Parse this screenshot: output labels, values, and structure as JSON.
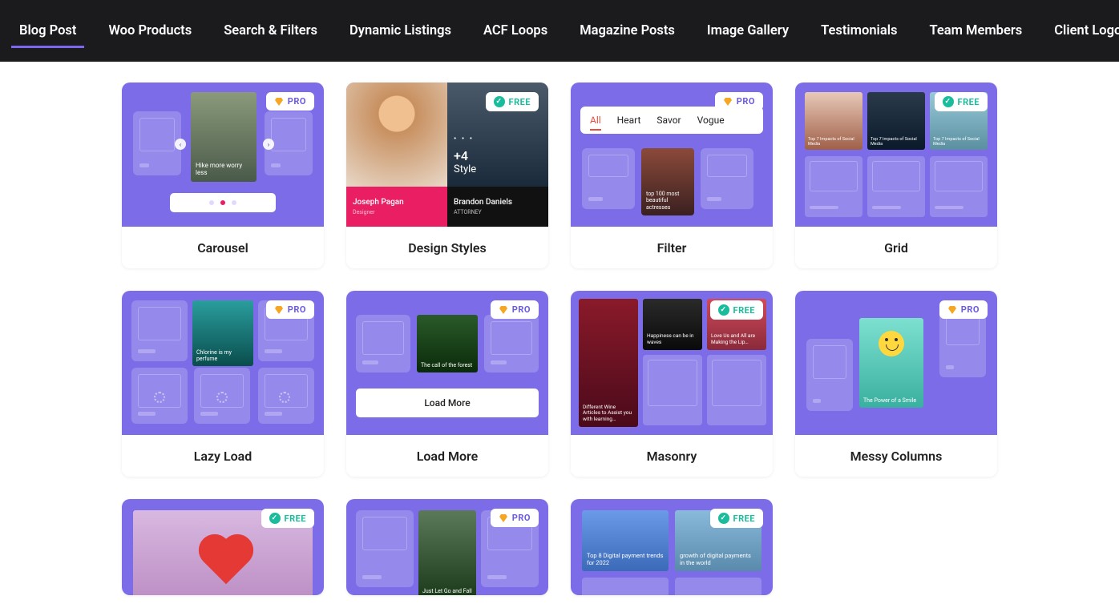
{
  "nav": {
    "items": [
      {
        "label": "Blog Post",
        "active": true
      },
      {
        "label": "Woo Products"
      },
      {
        "label": "Search & Filters"
      },
      {
        "label": "Dynamic Listings"
      },
      {
        "label": "ACF Loops"
      },
      {
        "label": "Magazine Posts"
      },
      {
        "label": "Image Gallery"
      },
      {
        "label": "Testimonials"
      },
      {
        "label": "Team Members"
      },
      {
        "label": "Client Logos"
      }
    ]
  },
  "badges": {
    "pro": "PRO",
    "free": "FREE"
  },
  "cards": {
    "carousel": {
      "title": "Carousel",
      "tier": "pro",
      "caption": "Hike more worry less"
    },
    "design_styles": {
      "title": "Design Styles",
      "tier": "free",
      "p1": {
        "name": "Joseph Pagan",
        "role": "Designer"
      },
      "p2": {
        "name": "Brandon Daniels",
        "role": "ATTORNEY"
      },
      "overlay_num": "+4",
      "overlay_word": "Style",
      "dots": "• • •"
    },
    "filter": {
      "title": "Filter",
      "tier": "pro",
      "tabs": [
        "All",
        "Heart",
        "Savor",
        "Vogue"
      ],
      "caption": "top 100 most beautiful actresses"
    },
    "grid": {
      "title": "Grid",
      "tier": "free",
      "tile_tag": "Social",
      "tile_caption": "Top 7 Impacts of Social Media"
    },
    "lazy": {
      "title": "Lazy Load",
      "tier": "pro",
      "caption": "Chlorine is my perfume"
    },
    "loadmore": {
      "title": "Load More",
      "tier": "pro",
      "caption": "The call of the forest",
      "button": "Load More"
    },
    "masonry": {
      "title": "Masonry",
      "tier": "free",
      "c1": "Different Wine Articles to Assist you with learning…",
      "c2": "Happiness can be in waves",
      "c3": "Love Us and All are Making the Lip…"
    },
    "messy": {
      "title": "Messy Columns",
      "tier": "pro",
      "caption": "The Power of a Smile"
    },
    "r9": {
      "tier": "free"
    },
    "r10": {
      "tier": "pro",
      "caption": "Just Let Go and Fall"
    },
    "r11": {
      "tier": "free",
      "c1": "Top 8 Digital payment trends for 2022",
      "c2": "growth of digital payments in the world"
    }
  }
}
